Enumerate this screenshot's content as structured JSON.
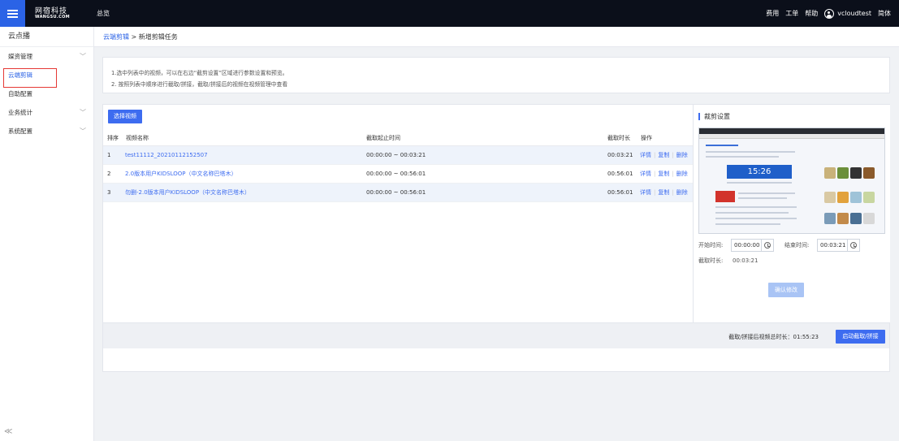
{
  "topbar": {
    "logo_cn": "网宿科技",
    "logo_en": "WANGSU.COM",
    "title": "总览",
    "links": [
      "费用",
      "工单",
      "帮助"
    ],
    "user": "vcloudtest",
    "lang": "简体"
  },
  "sidebar": {
    "title": "云点播",
    "items": [
      {
        "label": "媒资管理",
        "chevron": true
      },
      {
        "label": "云端剪辑",
        "chevron": false,
        "active": true
      },
      {
        "label": "自助配置",
        "chevron": false
      },
      {
        "label": "业务统计",
        "chevron": true
      },
      {
        "label": "系统配置",
        "chevron": true
      }
    ],
    "collapse": "≪"
  },
  "breadcrumb": {
    "parent": "云端剪辑",
    "separator": ">",
    "current": "新增剪辑任务"
  },
  "tips": [
    "1.选中列表中的视频，可以在右边“截剪设置”区域进行参数设置和预览。",
    "2. 按照列表中顺序进行截取/拼接，截取/拼接后的视频在视频管理中查看"
  ],
  "table": {
    "select_button": "选择视频",
    "headers": {
      "order": "排序",
      "name": "视频名称",
      "range": "截取起止时间",
      "duration": "截取时长",
      "ops": "操作"
    },
    "rows": [
      {
        "order": "1",
        "name": "test11112_20210112152507",
        "range": "00:00:00 ~ 00:03:21",
        "duration": "00:03:21"
      },
      {
        "order": "2",
        "name": "2.0版本用户KIDSLOOP（中文名称巴塔木）",
        "range": "00:00:00 ~ 00:56:01",
        "duration": "00:56:01"
      },
      {
        "order": "3",
        "name": "勿删-2.0版本用户KIDSLOOP（中文名称巴塔木）",
        "range": "00:00:00 ~ 00:56:01",
        "duration": "00:56:01"
      }
    ],
    "ops": {
      "detail": "详情",
      "copy": "复制",
      "delete": "删除"
    }
  },
  "clip_settings": {
    "title": "裁剪设置",
    "preview_clock": "15:26",
    "start_label": "开始时间:",
    "start_value": "00:00:00",
    "end_label": "结束时间:",
    "end_value": "00:03:21",
    "duration_label": "截取时长:",
    "duration_value": "00:03:21",
    "confirm": "确认修改"
  },
  "footer": {
    "total_label": "截取/拼接后视频总时长：01:55:23",
    "start_button": "启动截取/拼接"
  },
  "colors": {
    "accent": "#3d6cf0",
    "topbar": "#0b0f1a",
    "highlight": "#e53935"
  }
}
